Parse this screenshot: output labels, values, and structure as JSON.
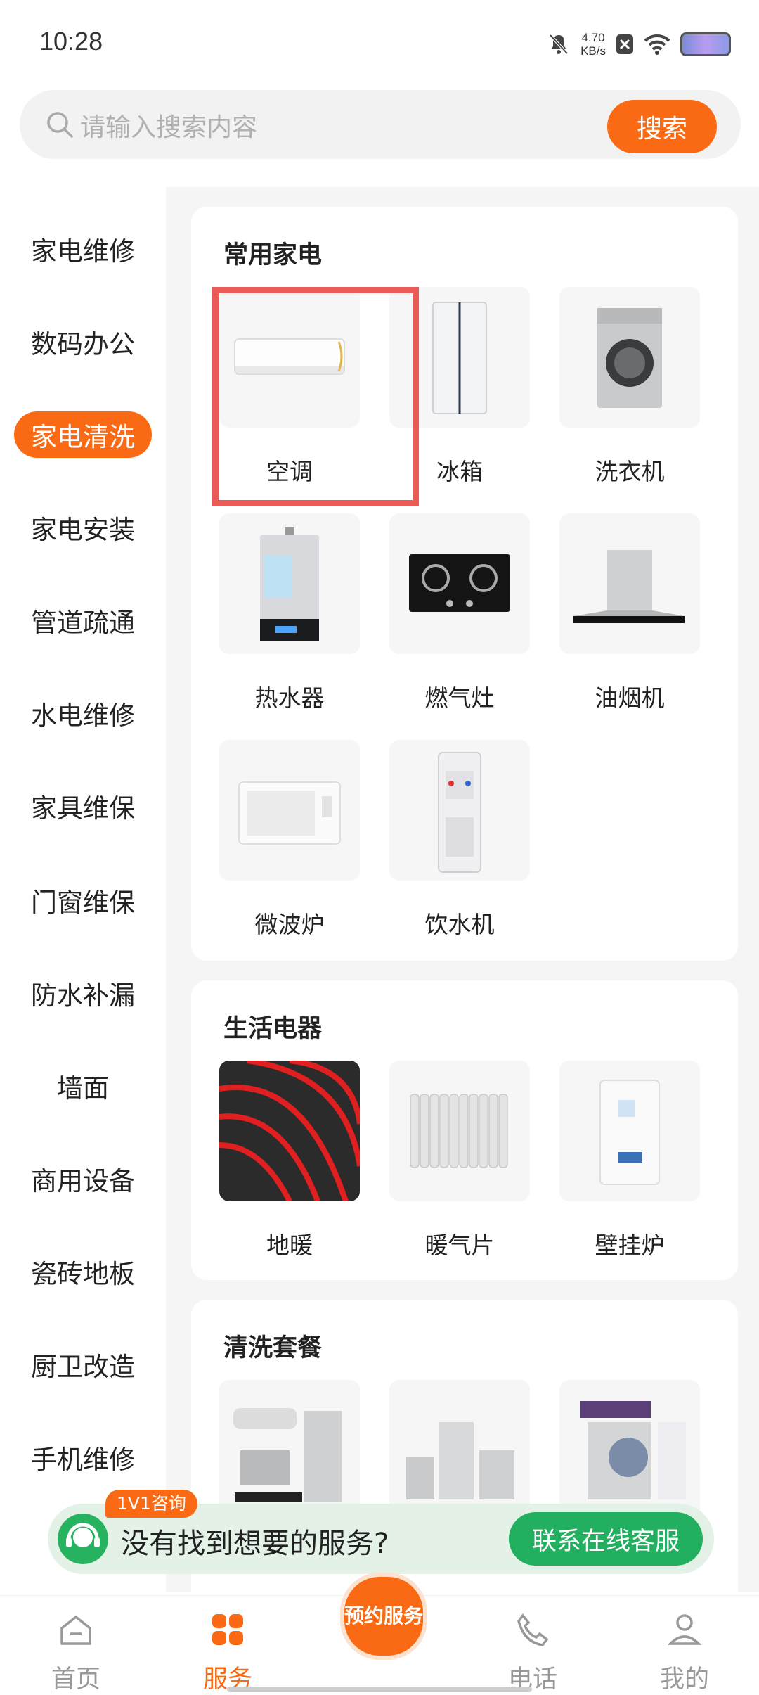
{
  "status_bar": {
    "time": "10:28",
    "speed_value": "4.70",
    "speed_unit": "KB/s"
  },
  "search": {
    "placeholder": "请输入搜索内容",
    "button": "搜索"
  },
  "sidebar": {
    "items": [
      {
        "label": "家电维修"
      },
      {
        "label": "数码办公"
      },
      {
        "label": "家电清洗",
        "active": true
      },
      {
        "label": "家电安装"
      },
      {
        "label": "管道疏通"
      },
      {
        "label": "水电维修"
      },
      {
        "label": "家具维保"
      },
      {
        "label": "门窗维保"
      },
      {
        "label": "防水补漏"
      },
      {
        "label": "墙面"
      },
      {
        "label": "商用设备"
      },
      {
        "label": "瓷砖地板"
      },
      {
        "label": "厨卫改造"
      },
      {
        "label": "手机维修"
      }
    ]
  },
  "sections": [
    {
      "title": "常用家电",
      "items": [
        {
          "label": "空调",
          "icon": "air-conditioner"
        },
        {
          "label": "冰箱",
          "icon": "refrigerator"
        },
        {
          "label": "洗衣机",
          "icon": "washing-machine"
        },
        {
          "label": "热水器",
          "icon": "water-heater"
        },
        {
          "label": "燃气灶",
          "icon": "gas-stove"
        },
        {
          "label": "油烟机",
          "icon": "range-hood"
        },
        {
          "label": "微波炉",
          "icon": "microwave"
        },
        {
          "label": "饮水机",
          "icon": "water-dispenser"
        }
      ]
    },
    {
      "title": "生活电器",
      "items": [
        {
          "label": "地暖",
          "icon": "floor-heating"
        },
        {
          "label": "暖气片",
          "icon": "radiator"
        },
        {
          "label": "壁挂炉",
          "icon": "wall-boiler"
        }
      ]
    },
    {
      "title": "清洗套餐",
      "items": [
        {
          "label": "",
          "icon": "cleaning-package"
        },
        {
          "label": "",
          "icon": "cleaning-package"
        },
        {
          "label": "",
          "icon": "cleaning-package"
        }
      ]
    }
  ],
  "promo": {
    "badge": "1V1咨询",
    "text": "没有找到想要的服务?",
    "button": "联系在线客服"
  },
  "tabbar": {
    "items": [
      {
        "label": "首页"
      },
      {
        "label": "服务",
        "active": true
      },
      {
        "label": "预约服务"
      },
      {
        "label": "电话"
      },
      {
        "label": "我的"
      }
    ]
  },
  "colors": {
    "accent": "#fa6a14",
    "green": "#22b060",
    "highlight": "#ea5a57"
  }
}
